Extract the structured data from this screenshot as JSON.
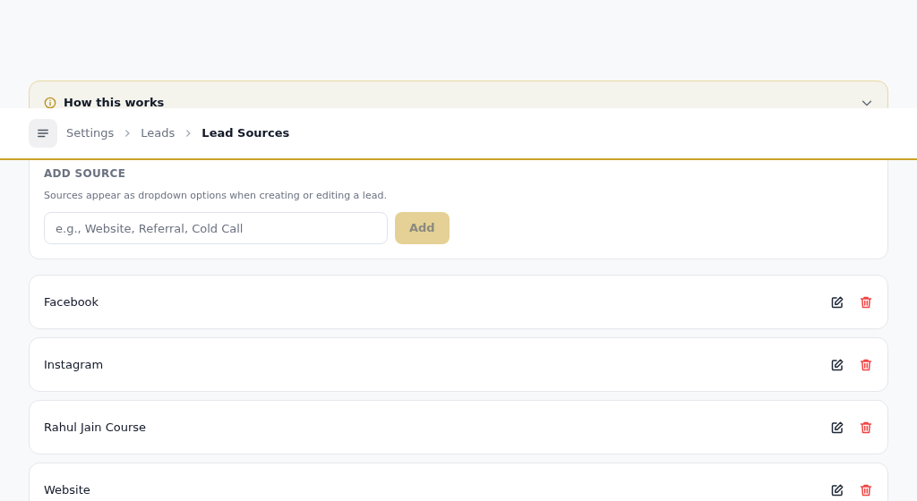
{
  "info_panel": {
    "title": "How this works",
    "expanded": false
  },
  "header": {
    "breadcrumbs": [
      {
        "label": "Settings",
        "current": false
      },
      {
        "label": "Leads",
        "current": false
      },
      {
        "label": "Lead Sources",
        "current": true
      }
    ]
  },
  "add_source": {
    "heading": "ADD SOURCE",
    "description": "Sources appear as dropdown options when creating or editing a lead.",
    "placeholder": "e.g., Website, Referral, Cold Call",
    "button": "Add",
    "disabled": true
  },
  "sources": [
    {
      "name": "Facebook"
    },
    {
      "name": "Instagram"
    },
    {
      "name": "Rahul Jain Course"
    },
    {
      "name": "Website"
    }
  ]
}
